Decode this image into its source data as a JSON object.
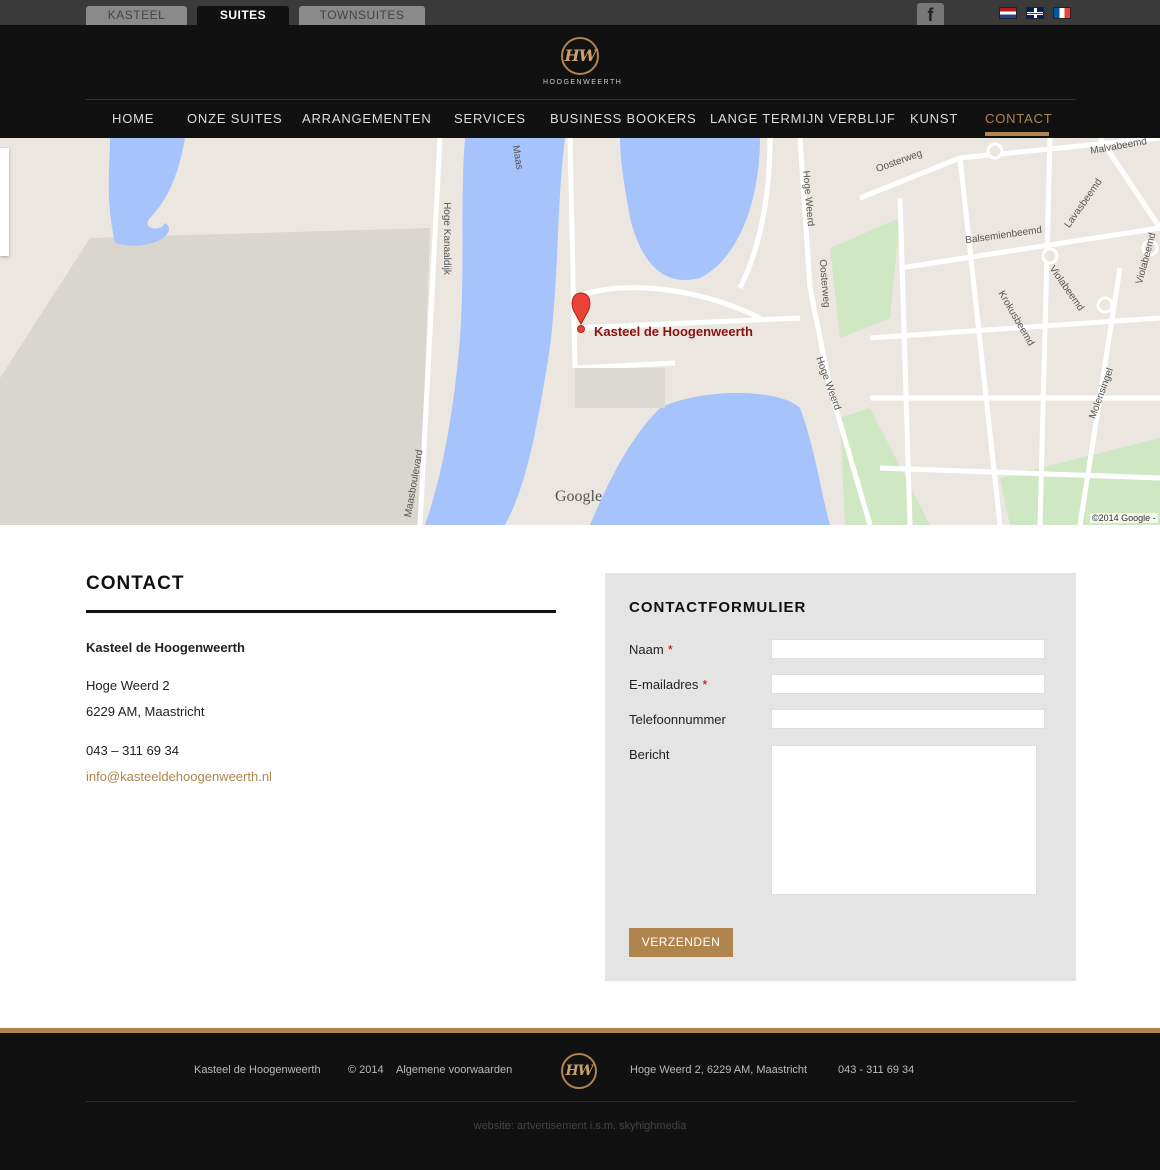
{
  "topbar": {
    "tabs": [
      {
        "label": "KASTEEL"
      },
      {
        "label": "SUITES"
      },
      {
        "label": "TOWNSUITES"
      }
    ],
    "facebook_icon": "f"
  },
  "header": {
    "logo_initials": "HW",
    "logo_name": "HOOGENWEERTH"
  },
  "nav": {
    "items": [
      {
        "label": "HOME"
      },
      {
        "label": "ONZE SUITES"
      },
      {
        "label": "ARRANGEMENTEN"
      },
      {
        "label": "SERVICES"
      },
      {
        "label": "BUSINESS BOOKERS"
      },
      {
        "label": "LANGE TERMIJN VERBLIJF"
      },
      {
        "label": "KUNST"
      },
      {
        "label": "CONTACT"
      }
    ],
    "active_color": "#b0854d"
  },
  "map": {
    "marker_label": "Kasteel de Hoogenweerth",
    "labels": {
      "maas": "Maas",
      "hoge_kanaaldijk": "Hoge Kanaaldijk",
      "maasboulevard": "Maasboulevard",
      "hoge_weerd_1": "Hoge Weerd",
      "hoge_weerd_2": "Hoge Weerd",
      "oosterweg": "Oosterweg",
      "oosterweg_2": "Oosterweg",
      "balsemienbeemd": "Balsemienbeemd",
      "malvabeemd": "Malvabeemd",
      "lavasbeemd": "Lavasbeemd",
      "violabeemd": "Violabeemd",
      "violabeemd_2": "Violabeemd",
      "krokusbeemd": "Krokusbeemd",
      "molensingel": "Molensingel"
    },
    "google": "Google",
    "copyright": "©2014 Google -"
  },
  "contact": {
    "title": "CONTACT",
    "name": "Kasteel de Hoogenweerth",
    "street": "Hoge Weerd 2",
    "city": "6229 AM, Maastricht",
    "phone": "043 – 311 69 34",
    "email": "info@kasteeldehoogenweerth.nl"
  },
  "form": {
    "title": "CONTACTFORMULIER",
    "fields": {
      "naam": {
        "label": "Naam",
        "required": "*",
        "value": ""
      },
      "email": {
        "label": "E-mailadres",
        "required": "*",
        "value": ""
      },
      "telefoon": {
        "label": "Telefoonnummer",
        "value": ""
      },
      "bericht": {
        "label": "Bericht",
        "value": ""
      }
    },
    "submit": "VERZENDEN"
  },
  "footer": {
    "name": "Kasteel de Hoogenweerth",
    "year": "© 2014",
    "terms": "Algemene voorwaarden",
    "logo_initials": "HW",
    "address": "Hoge Weerd 2, 6229 AM, Maastricht",
    "phone": "043 - 311 69 34",
    "credit": "website: artvertisement i.s.m. skyhighmedia"
  },
  "colors": {
    "accent": "#b0854d",
    "dark": "#111111",
    "water": "#a6c3fb"
  }
}
